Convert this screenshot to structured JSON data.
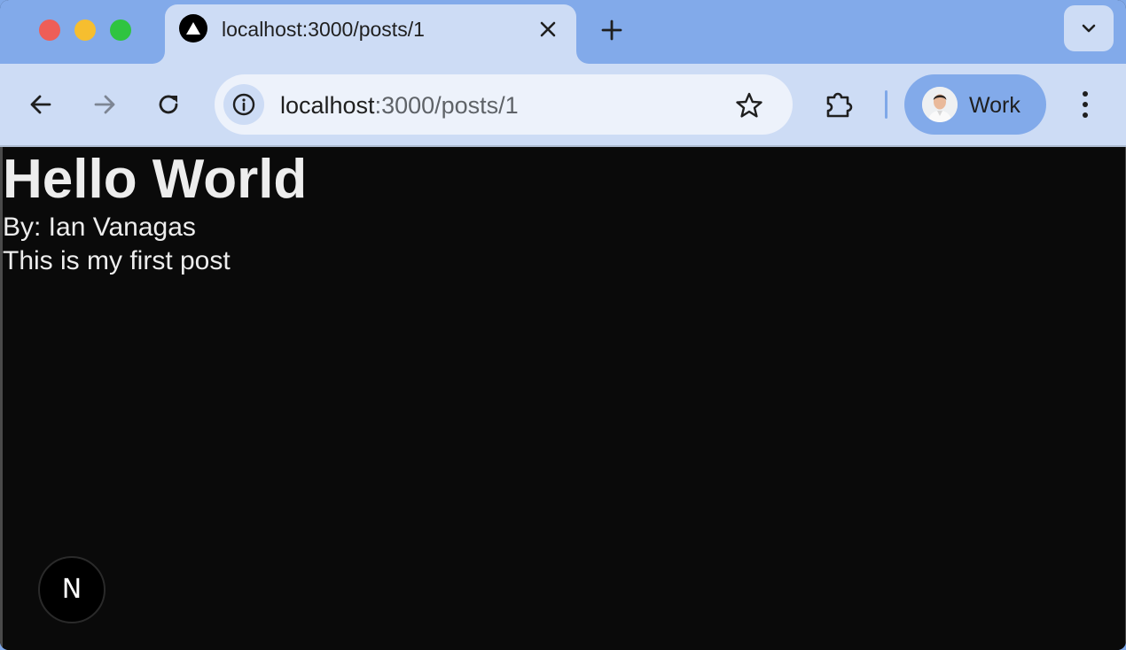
{
  "browser": {
    "tab": {
      "title": "localhost:3000/posts/1",
      "favicon": "vercel-triangle-icon"
    },
    "address_bar": {
      "host": "localhost",
      "rest": ":3000/posts/1"
    },
    "profile": {
      "label": "Work"
    },
    "colors": {
      "tabstrip": "#82aaea",
      "toolbar": "#cddcf5",
      "omnibox": "#edf2fb",
      "page_bg": "#0a0a0a"
    }
  },
  "page": {
    "title": "Hello World",
    "author": "By: Ian Vanagas",
    "body": "This is my first post",
    "next_badge": "N"
  }
}
